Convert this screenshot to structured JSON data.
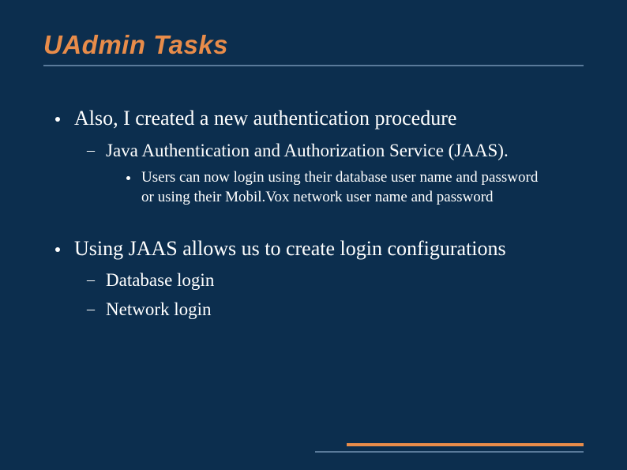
{
  "title": "UAdmin Tasks",
  "content": {
    "item1": {
      "text": "Also, I created a new authentication procedure",
      "sub1": {
        "text": "Java Authentication and Authorization Service (JAAS).",
        "sub1_1": {
          "text": "Users can now login using their database user name and password or using their Mobil.Vox network user name and password"
        }
      }
    },
    "item2": {
      "text": "Using JAAS allows us to create login configurations",
      "sub1": {
        "text": "Database login"
      },
      "sub2": {
        "text": "Network login"
      }
    }
  }
}
